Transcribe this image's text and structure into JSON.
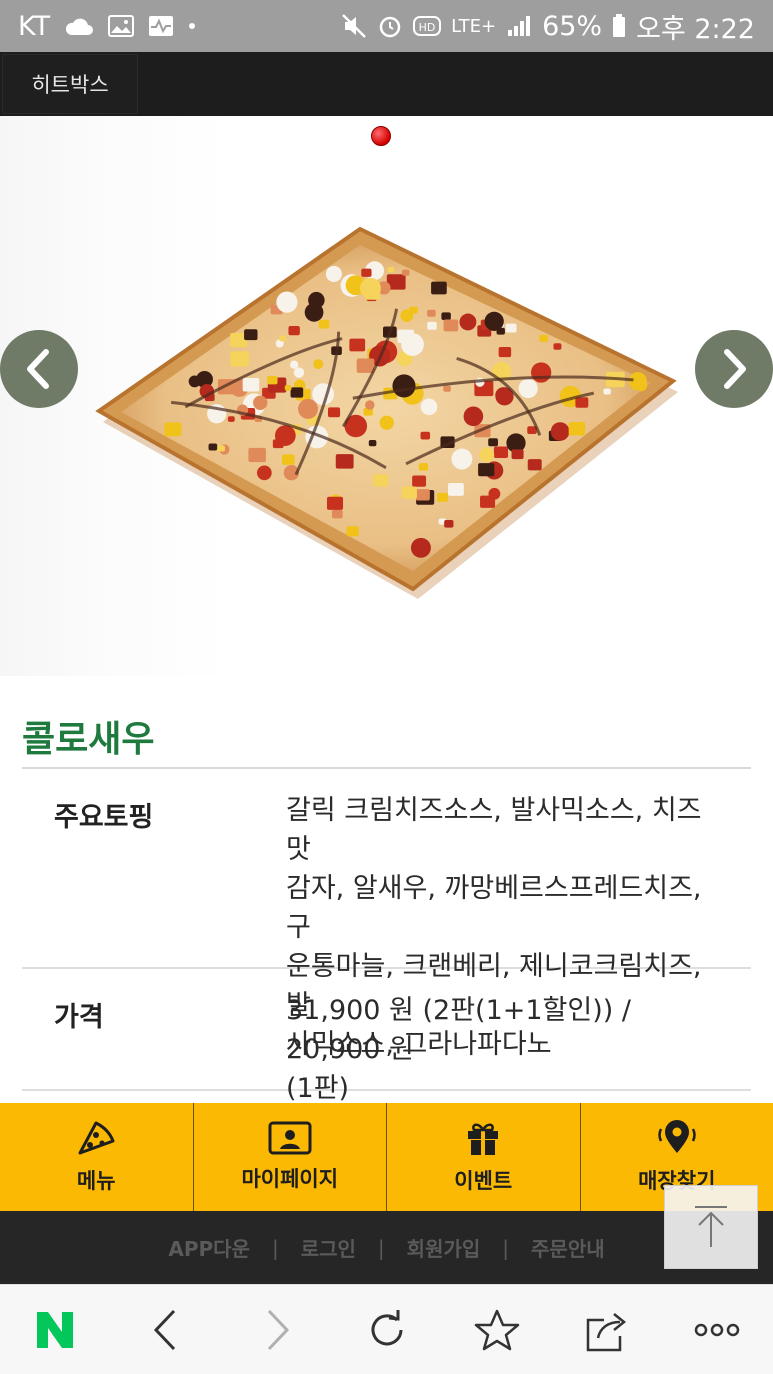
{
  "status_bar": {
    "carrier": "KT",
    "network": "LTE+",
    "battery": "65%",
    "time": "오후 2:22"
  },
  "nav": {
    "site_tab": "히트박스"
  },
  "carousel": {
    "image_alt": "pizza"
  },
  "product": {
    "name": "콜로새우",
    "rows": [
      {
        "label": "주요토핑",
        "lines": [
          "갈릭 크림치즈소스, 발사믹소스, 치즈맛",
          "감자, 알새우, 까망베르스프레드치즈, 구",
          "운통마늘, 크랜베리, 제니코크림치즈, 발",
          "사믹소스, 그라나파다노"
        ]
      },
      {
        "label": "가격",
        "lines": [
          "31,900 원 (2판(1+1할인)) / 20,900 원",
          "(1판)"
        ]
      }
    ]
  },
  "bottom_nav": [
    {
      "label": "메뉴",
      "icon": "pizza-slice-icon"
    },
    {
      "label": "마이페이지",
      "icon": "profile-card-icon"
    },
    {
      "label": "이벤트",
      "icon": "gift-icon"
    },
    {
      "label": "매장찾기",
      "icon": "location-pin-icon"
    }
  ],
  "footer_links": [
    "APP다운",
    "로그인",
    "회원가입",
    "주문안내"
  ],
  "colors": {
    "accent_green": "#1f7a3e",
    "nav_yellow": "#fbb903",
    "naver_green": "#03c75a"
  }
}
